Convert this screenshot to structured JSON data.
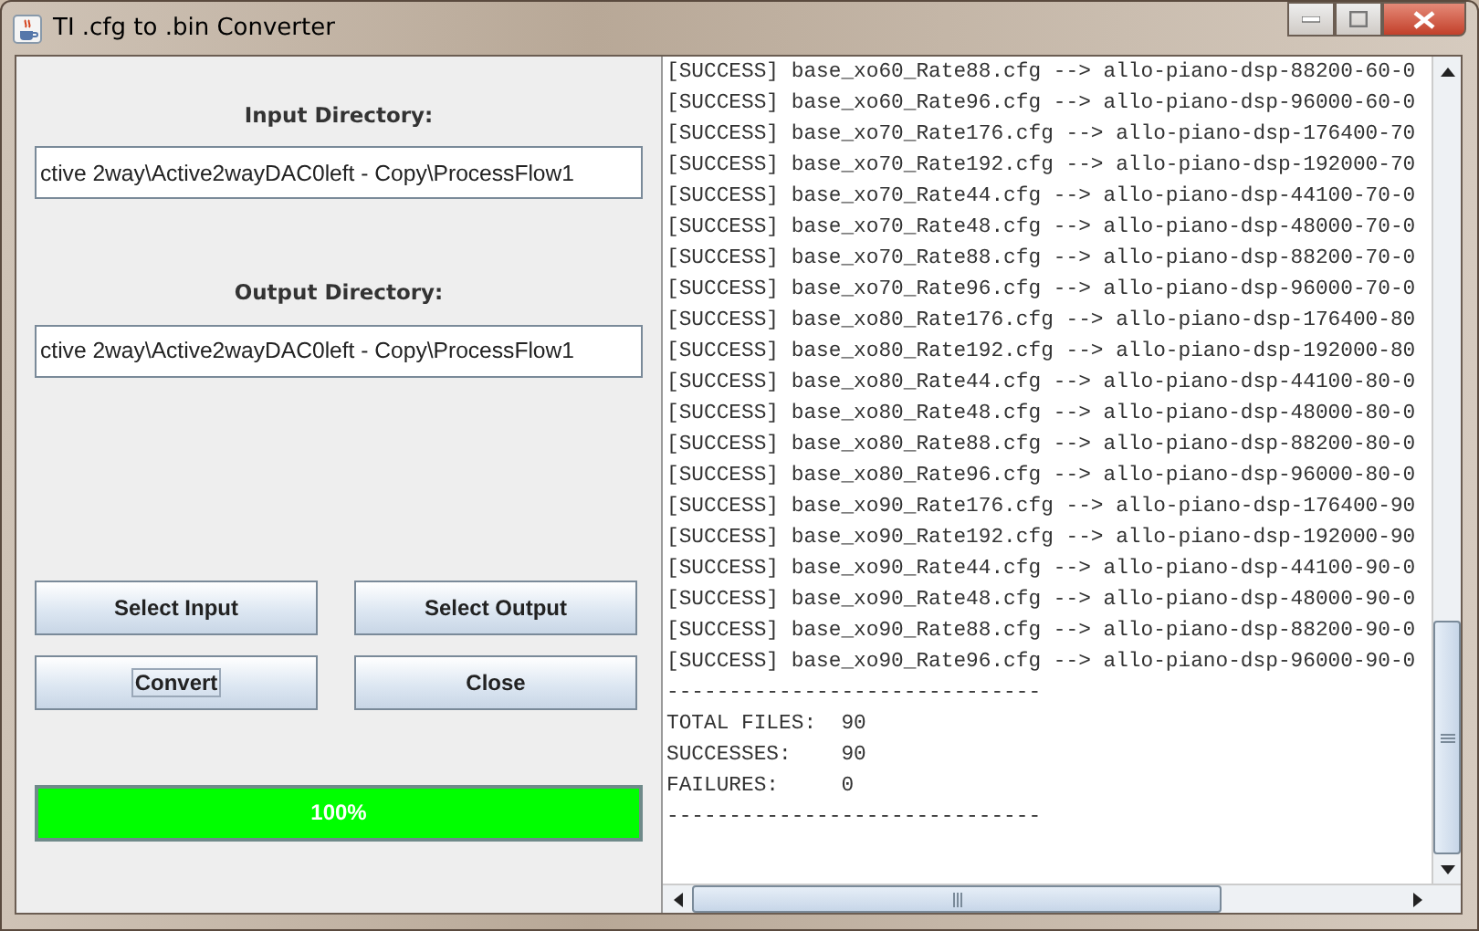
{
  "window": {
    "title": "TI .cfg to .bin Converter"
  },
  "input_directory": {
    "label": "Input Directory:",
    "value": "ctive 2way\\Active2wayDAC0left - Copy\\ProcessFlow1"
  },
  "output_directory": {
    "label": "Output Directory:",
    "value": "ctive 2way\\Active2wayDAC0left - Copy\\ProcessFlow1"
  },
  "buttons": [
    {
      "label": "Select Input",
      "focused": false
    },
    {
      "label": "Select Output",
      "focused": false
    },
    {
      "label": "Convert",
      "focused": true
    },
    {
      "label": "Close",
      "focused": false
    }
  ],
  "progress": {
    "level": 1,
    "text": "100%"
  },
  "log": [
    "[SUCCESS] base_xo60_Rate88.cfg --> allo-piano-dsp-88200-60-0",
    "[SUCCESS] base_xo60_Rate96.cfg --> allo-piano-dsp-96000-60-0",
    "[SUCCESS] base_xo70_Rate176.cfg --> allo-piano-dsp-176400-70",
    "[SUCCESS] base_xo70_Rate192.cfg --> allo-piano-dsp-192000-70",
    "[SUCCESS] base_xo70_Rate44.cfg --> allo-piano-dsp-44100-70-0",
    "[SUCCESS] base_xo70_Rate48.cfg --> allo-piano-dsp-48000-70-0",
    "[SUCCESS] base_xo70_Rate88.cfg --> allo-piano-dsp-88200-70-0",
    "[SUCCESS] base_xo70_Rate96.cfg --> allo-piano-dsp-96000-70-0",
    "[SUCCESS] base_xo80_Rate176.cfg --> allo-piano-dsp-176400-80",
    "[SUCCESS] base_xo80_Rate192.cfg --> allo-piano-dsp-192000-80",
    "[SUCCESS] base_xo80_Rate44.cfg --> allo-piano-dsp-44100-80-0",
    "[SUCCESS] base_xo80_Rate48.cfg --> allo-piano-dsp-48000-80-0",
    "[SUCCESS] base_xo80_Rate88.cfg --> allo-piano-dsp-88200-80-0",
    "[SUCCESS] base_xo80_Rate96.cfg --> allo-piano-dsp-96000-80-0",
    "[SUCCESS] base_xo90_Rate176.cfg --> allo-piano-dsp-176400-90",
    "[SUCCESS] base_xo90_Rate192.cfg --> allo-piano-dsp-192000-90",
    "[SUCCESS] base_xo90_Rate44.cfg --> allo-piano-dsp-44100-90-0",
    "[SUCCESS] base_xo90_Rate48.cfg --> allo-piano-dsp-48000-90-0",
    "[SUCCESS] base_xo90_Rate88.cfg --> allo-piano-dsp-88200-90-0",
    "[SUCCESS] base_xo90_Rate96.cfg --> allo-piano-dsp-96000-90-0",
    "------------------------------",
    "TOTAL FILES:  90",
    "SUCCESSES:    90",
    "FAILURES:     0",
    "------------------------------"
  ]
}
